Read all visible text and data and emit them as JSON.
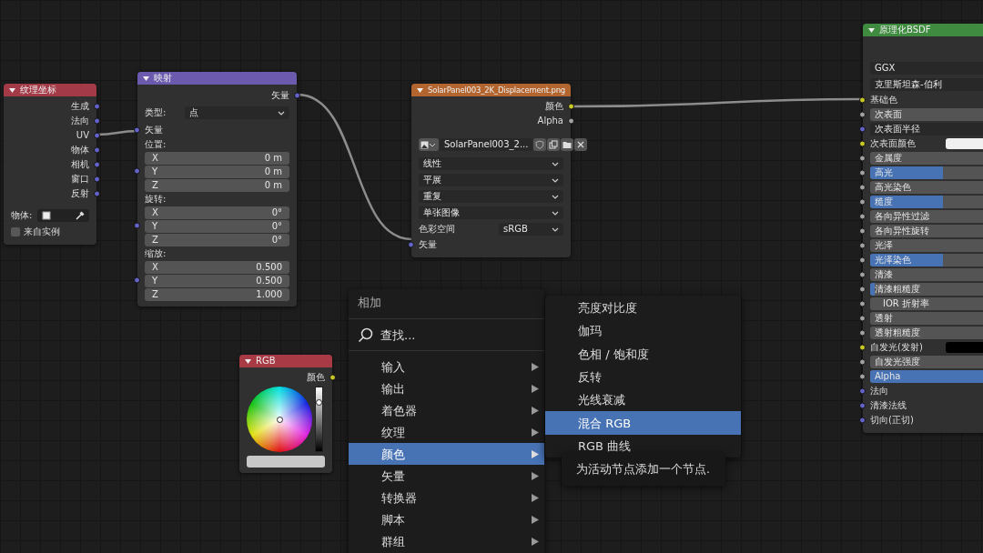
{
  "nodes": [
    {
      "title": "纹理坐标",
      "color": "#a33a47",
      "rows": [
        {
          "kind": "output",
          "label": "生成",
          "socket": {
            "color": "#6363c7"
          }
        },
        {
          "kind": "output",
          "label": "法向",
          "socket": {
            "color": "#6363c7"
          }
        },
        {
          "kind": "output",
          "label": "UV",
          "socket": {
            "color": "#6363c7"
          }
        },
        {
          "kind": "output",
          "label": "物体",
          "socket": {
            "color": "#6363c7"
          }
        },
        {
          "kind": "output",
          "label": "相机",
          "socket": {
            "color": "#6363c7"
          }
        },
        {
          "kind": "output",
          "label": "窗口",
          "socket": {
            "color": "#6363c7"
          }
        },
        {
          "kind": "output",
          "label": "反射",
          "socket": {
            "color": "#6363c7"
          }
        },
        {
          "kind": "object",
          "label": "物体:"
        },
        {
          "kind": "checkbox",
          "label": "来自实例",
          "checked": false
        }
      ]
    },
    {
      "title": "映射",
      "color": "#6b5aae",
      "rows": [
        {
          "kind": "output",
          "label": "矢量",
          "socket": {
            "color": "#6363c7"
          }
        },
        {
          "kind": "select",
          "label": "类型:",
          "value": "点"
        },
        {
          "kind": "input",
          "label": "矢量",
          "socket": {
            "color": "#6363c7"
          }
        },
        {
          "kind": "vector",
          "label": "位置:",
          "socket": {
            "color": "#6363c7"
          },
          "fields": [
            {
              "axis": "X",
              "value": "0 m"
            },
            {
              "axis": "Y",
              "value": "0 m"
            },
            {
              "axis": "Z",
              "value": "0 m"
            }
          ]
        },
        {
          "kind": "vector",
          "label": "旋转:",
          "socket": {
            "color": "#6363c7"
          },
          "fields": [
            {
              "axis": "X",
              "value": "0°"
            },
            {
              "axis": "Y",
              "value": "0°"
            },
            {
              "axis": "Z",
              "value": "0°"
            }
          ]
        },
        {
          "kind": "vector",
          "label": "缩放:",
          "socket": {
            "color": "#6363c7"
          },
          "fields": [
            {
              "axis": "X",
              "value": "0.500"
            },
            {
              "axis": "Y",
              "value": "0.500"
            },
            {
              "axis": "Z",
              "value": "1.000"
            }
          ]
        }
      ]
    },
    {
      "title": "SolarPanel003_2K_Displacement.png",
      "color": "#b3652f",
      "rows": [
        {
          "kind": "output",
          "label": "颜色",
          "socket": {
            "color": "#c7c729"
          }
        },
        {
          "kind": "output",
          "label": "Alpha",
          "socket": {
            "color": "#a1a1a1"
          }
        },
        {
          "kind": "image",
          "value": "SolarPanel003_2..."
        },
        {
          "kind": "select",
          "value": "线性"
        },
        {
          "kind": "select",
          "value": "平展"
        },
        {
          "kind": "select",
          "value": "重复"
        },
        {
          "kind": "select",
          "value": "单张图像"
        },
        {
          "kind": "select",
          "label": "色彩空间",
          "value": "sRGB"
        },
        {
          "kind": "input",
          "label": "矢量",
          "socket": {
            "color": "#6363c7"
          }
        }
      ]
    },
    {
      "title": "原理化BSDF",
      "color": "#3f8b3f",
      "rows": [
        {
          "kind": "select",
          "value": "GGX"
        },
        {
          "kind": "select",
          "value": "克里斯坦森-伯利"
        },
        {
          "kind": "input",
          "label": "基础色",
          "socket": {
            "color": "#c7c729"
          }
        },
        {
          "kind": "slider",
          "label": "次表面",
          "level": 0,
          "socket": {
            "color": "#a1a1a1"
          }
        },
        {
          "kind": "vector-select",
          "label": "次表面半径",
          "socket": {
            "color": "#6363c7"
          }
        },
        {
          "kind": "swatch",
          "label": "次表面颜色",
          "socket": {
            "color": "#c7c729"
          },
          "color": "#f0f0f0"
        },
        {
          "kind": "slider",
          "label": "金属度",
          "level": 0,
          "socket": {
            "color": "#a1a1a1"
          }
        },
        {
          "kind": "slider",
          "label": "高光",
          "level": 0.5,
          "socket": {
            "color": "#a1a1a1"
          }
        },
        {
          "kind": "slider",
          "label": "高光染色",
          "level": 0,
          "socket": {
            "color": "#a1a1a1"
          }
        },
        {
          "kind": "slider",
          "label": "糙度",
          "level": 0.5,
          "socket": {
            "color": "#a1a1a1"
          }
        },
        {
          "kind": "slider",
          "label": "各向异性过滤",
          "level": 0,
          "socket": {
            "color": "#a1a1a1"
          }
        },
        {
          "kind": "slider",
          "label": "各向异性旋转",
          "level": 0,
          "socket": {
            "color": "#a1a1a1"
          }
        },
        {
          "kind": "slider",
          "label": "光泽",
          "level": 0,
          "socket": {
            "color": "#a1a1a1"
          }
        },
        {
          "kind": "slider",
          "label": "光泽染色",
          "level": 0.5,
          "socket": {
            "color": "#a1a1a1"
          }
        },
        {
          "kind": "slider",
          "label": "清漆",
          "level": 0,
          "socket": {
            "color": "#a1a1a1"
          }
        },
        {
          "kind": "slider",
          "label": "清漆粗糙度",
          "level": 0.03,
          "socket": {
            "color": "#a1a1a1"
          }
        },
        {
          "kind": "slider",
          "label": "IOR 折射率",
          "level": 0,
          "socket": {
            "color": "#a1a1a1"
          }
        },
        {
          "kind": "slider",
          "label": "透射",
          "level": 0,
          "socket": {
            "color": "#a1a1a1"
          }
        },
        {
          "kind": "slider",
          "label": "透射粗糙度",
          "level": 0,
          "socket": {
            "color": "#a1a1a1"
          }
        },
        {
          "kind": "swatch",
          "label": "自发光(发射)",
          "socket": {
            "color": "#c7c729"
          },
          "color": "#000000"
        },
        {
          "kind": "slider",
          "label": "自发光强度",
          "level": 0,
          "socket": {
            "color": "#a1a1a1"
          }
        },
        {
          "kind": "slider",
          "label": "Alpha",
          "level": 1,
          "socket": {
            "color": "#a1a1a1"
          }
        },
        {
          "kind": "input",
          "label": "法向",
          "socket": {
            "color": "#6363c7"
          }
        },
        {
          "kind": "input",
          "label": "清漆法线",
          "socket": {
            "color": "#6363c7"
          }
        },
        {
          "kind": "input",
          "label": "切向(正切)",
          "socket": {
            "color": "#6363c7"
          }
        }
      ]
    },
    {
      "title": "RGB",
      "color": "#a83a45",
      "rows": [
        {
          "kind": "output",
          "label": "颜色",
          "socket": {
            "color": "#c7c729"
          }
        },
        {
          "kind": "wheel",
          "level": 0.8,
          "color": "#c8c8c8"
        }
      ]
    }
  ],
  "menu": {
    "title": "相加",
    "search": "查找...",
    "items": [
      {
        "label": "输入",
        "selected": false
      },
      {
        "label": "输出",
        "selected": false
      },
      {
        "label": "着色器",
        "selected": false
      },
      {
        "label": "纹理",
        "selected": false
      },
      {
        "label": "颜色",
        "selected": true
      },
      {
        "label": "矢量",
        "selected": false
      },
      {
        "label": "转换器",
        "selected": false
      },
      {
        "label": "脚本",
        "selected": false
      },
      {
        "label": "群组",
        "selected": false
      }
    ]
  },
  "submenu": {
    "items": [
      {
        "label": "亮度对比度",
        "selected": false
      },
      {
        "label": "伽玛",
        "selected": false
      },
      {
        "label": "色相 / 饱和度",
        "selected": false
      },
      {
        "label": "反转",
        "selected": false
      },
      {
        "label": "光线衰减",
        "selected": false
      },
      {
        "label": "混合 RGB",
        "selected": true
      },
      {
        "label": "RGB 曲线",
        "selected": false
      }
    ]
  },
  "tooltip": {
    "text": "为活动节点添加一个节点."
  }
}
